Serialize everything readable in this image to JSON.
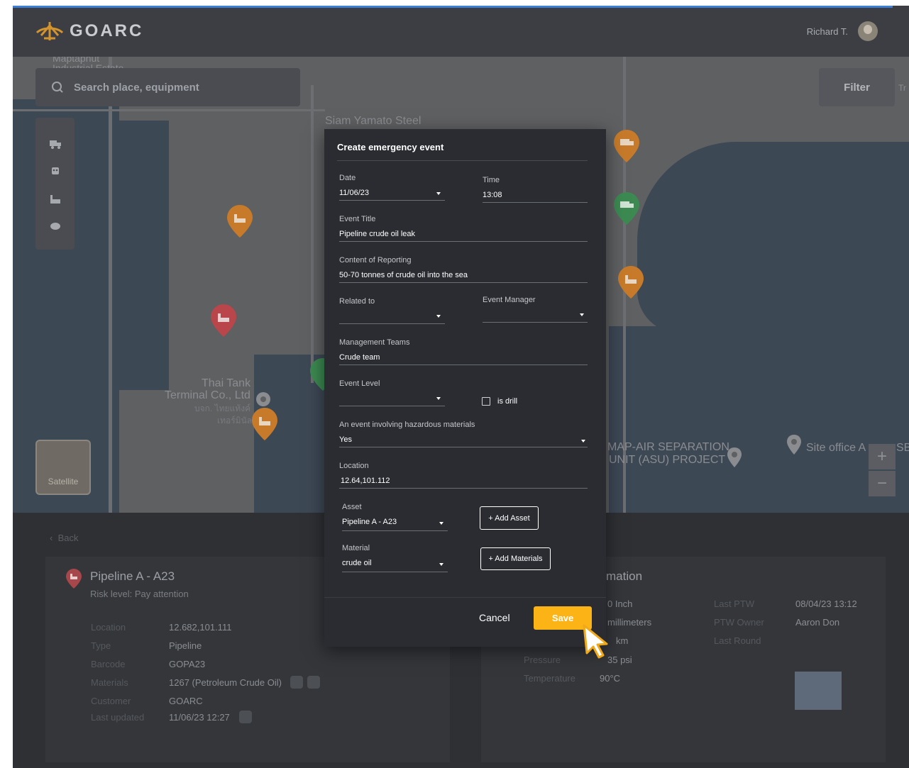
{
  "app": {
    "brand": "GOARC",
    "user_name": "Richard T."
  },
  "map": {
    "search_placeholder": "Search place, equipment",
    "filter_label": "Filter",
    "satellite_label": "Satellite",
    "zoom_in": "+",
    "zoom_out": "−",
    "labels": {
      "steel": "Siam Yamato Steel",
      "tank_line1": "Thai Tank",
      "tank_line2": "Terminal Co., Ltd",
      "tank_thai1": "บจก. ไทยแท้งค์",
      "tank_thai2": "เทอร์มินัล",
      "asu_line1": "MAP-AIR SEPARATION",
      "asu_line2": "UNIT (ASU) PROJECT",
      "site_office": "Site office A",
      "sb": "SB",
      "tr": "Tr",
      "industrial_top": "Maptaphut",
      "industrial": "Industrial Estate"
    }
  },
  "panel": {
    "back_label": "Back",
    "asset_name": "Pipeline A - A23",
    "risk_level": "Risk level: Pay attention",
    "fields": [
      {
        "key": "Location",
        "value": "12.682,101.111"
      },
      {
        "key": "Type",
        "value": "Pipeline"
      },
      {
        "key": "Barcode",
        "value": "GOPA23"
      },
      {
        "key": "Materials",
        "value": "1267 (Petroleum Crude Oil)"
      },
      {
        "key": "Customer",
        "value": "GOARC"
      },
      {
        "key": "Last updated",
        "value": "11/06/23 12:27"
      }
    ],
    "info_title": "mation",
    "specs": [
      {
        "key": "",
        "value": "0 Inch"
      },
      {
        "key": "",
        "value": "millimeters"
      },
      {
        "key": "",
        "value": "km"
      },
      {
        "key": "Pressure",
        "value": "35 psi"
      },
      {
        "key": "Temperature",
        "value": "90°C"
      }
    ],
    "ptw": [
      {
        "key": "Last PTW",
        "value": "08/04/23 13:12"
      },
      {
        "key": "PTW Owner",
        "value": "Aaron Don"
      },
      {
        "key": "Last Round",
        "value": ""
      }
    ]
  },
  "modal": {
    "title": "Create emergency event",
    "date_label": "Date",
    "date_value": "11/06/23",
    "time_label": "Time",
    "time_value": "13:08",
    "event_title_label": "Event Title",
    "event_title_value": "Pipeline crude oil leak",
    "content_label": "Content of Reporting",
    "content_value": "50-70 tonnes of crude oil into the sea",
    "related_label": "Related to",
    "related_value": "",
    "manager_label": "Event Manager",
    "manager_value": "",
    "teams_label": "Management Teams",
    "teams_value": "Crude team",
    "level_label": "Event Level",
    "level_value": "",
    "drill_label": "is drill",
    "hazard_label": "An event involving hazardous materials",
    "hazard_value": "Yes",
    "location_label": "Location",
    "location_value": "12.64,101.112",
    "asset_label": "Asset",
    "asset_value": "Pipeline A - A23",
    "add_asset": "+ Add Asset",
    "material_label": "Material",
    "material_value": "crude oil",
    "add_materials": "+ Add Materials",
    "cancel": "Cancel",
    "save": "Save"
  },
  "colors": {
    "accent": "#fbb316",
    "pin_orange": "#c77b2a",
    "pin_red": "#b8464a",
    "pin_green": "#3c8a52"
  }
}
